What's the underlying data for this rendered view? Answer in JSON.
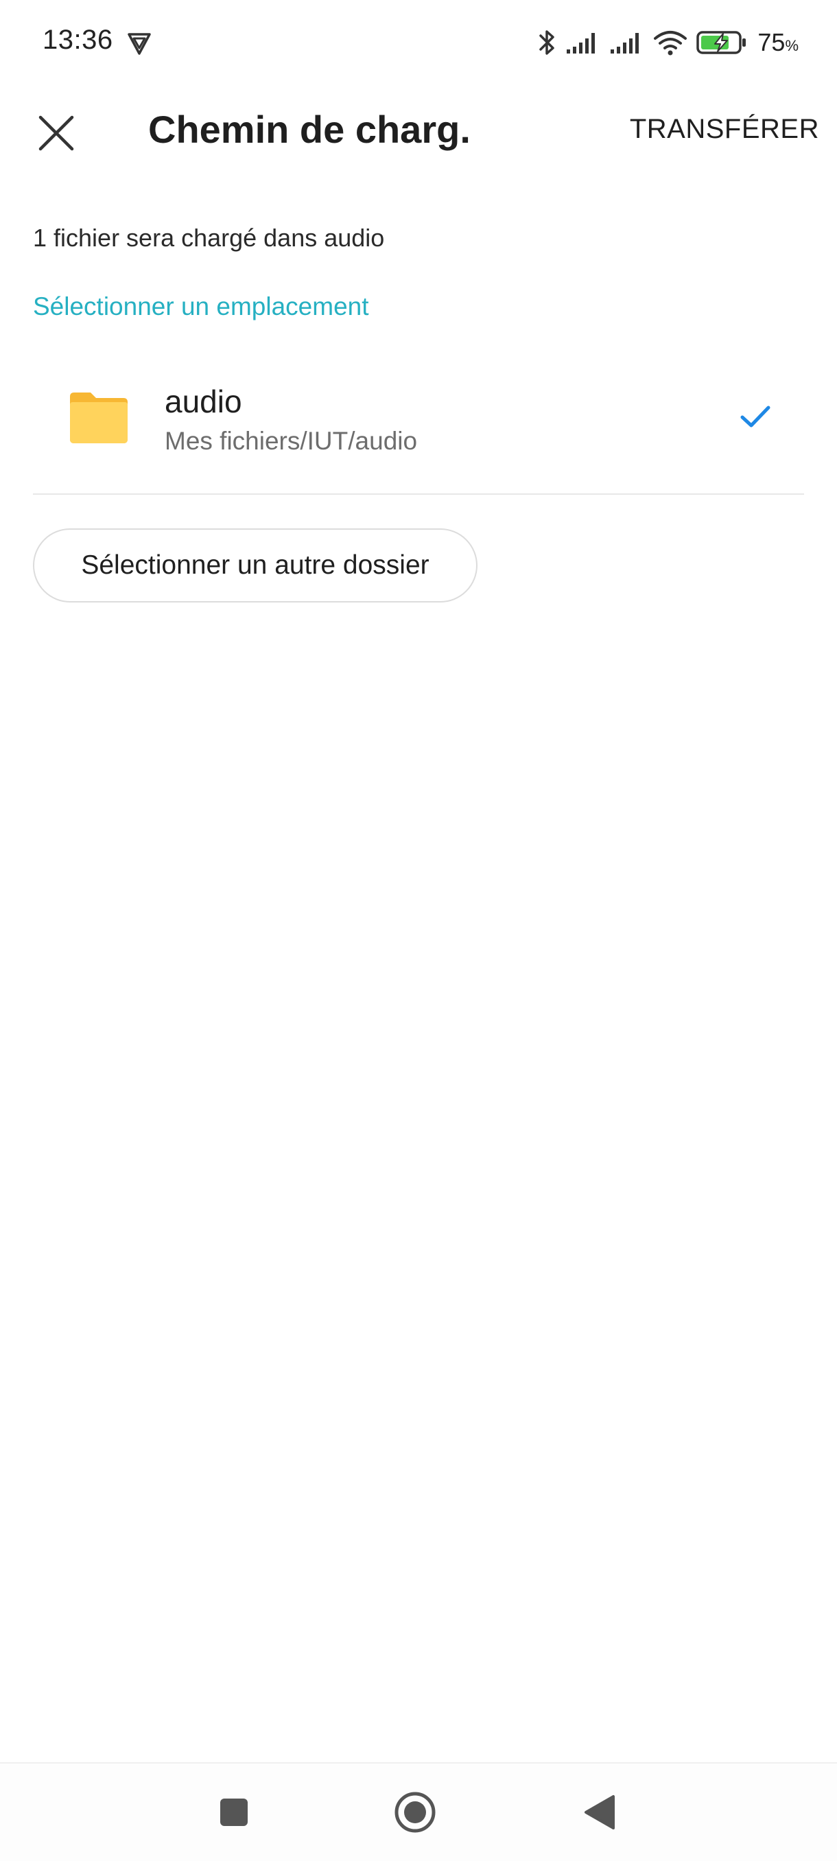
{
  "status_bar": {
    "time": "13:36",
    "shield_icon": "shield-vpn-icon",
    "icons": [
      "bluetooth-icon",
      "signal-icon",
      "signal-icon",
      "wifi-icon",
      "battery-charging-icon"
    ],
    "battery_percent": "75",
    "battery_unit": "%"
  },
  "toolbar": {
    "close_icon": "close-icon",
    "title": "Chemin de charg.",
    "transfer_label": "TRANSFÉRER"
  },
  "content": {
    "info_text": "1 fichier sera chargé dans audio",
    "section_header": "Sélectionner un emplacement",
    "section_color": "#26b0c2",
    "location": {
      "name": "audio",
      "path": "Mes fichiers/IUT/audio",
      "icon": "folder-icon",
      "selected": true,
      "check_color": "#1e88e5"
    },
    "other_folder_label": "Sélectionner un autre dossier"
  },
  "nav_bar": {
    "recent_icon": "square-icon",
    "home_icon": "circle-home-icon",
    "back_icon": "triangle-back-icon"
  }
}
